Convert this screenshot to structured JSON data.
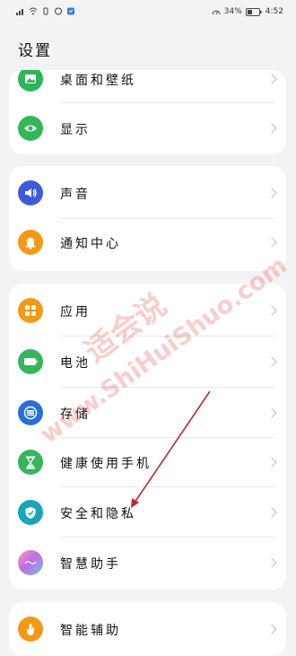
{
  "status_bar": {
    "battery_percent": "34%",
    "time": "4:52"
  },
  "header": {
    "title": "设置"
  },
  "cards": [
    {
      "items": [
        {
          "label": "桌面和壁纸",
          "icon": "wallpaper-icon",
          "color": "#2fb35b"
        },
        {
          "label": "显示",
          "icon": "eye-icon",
          "color": "#35b65b"
        }
      ]
    },
    {
      "items": [
        {
          "label": "声音",
          "icon": "speaker-icon",
          "color": "#3d5bd9"
        },
        {
          "label": "通知中心",
          "icon": "bell-icon",
          "color": "#f29a17"
        }
      ]
    },
    {
      "items": [
        {
          "label": "应用",
          "icon": "apps-icon",
          "color": "#f29a17"
        },
        {
          "label": "电池",
          "icon": "battery-icon",
          "color": "#35b65b"
        },
        {
          "label": "存储",
          "icon": "storage-icon",
          "color": "#2a6ed8"
        },
        {
          "label": "健康使用手机",
          "icon": "hourglass-icon",
          "color": "#35b65b"
        },
        {
          "label": "安全和隐私",
          "icon": "shield-icon",
          "color": "#1aa6b8"
        },
        {
          "label": "智慧助手",
          "icon": "assistant-icon",
          "color": "#c26ae0"
        }
      ]
    },
    {
      "items": [
        {
          "label": "智能辅助",
          "icon": "hand-icon",
          "color": "#f29a17"
        }
      ]
    }
  ],
  "watermark": {
    "line1": "适会说",
    "line2": "www.ShiHuiShuo.com"
  }
}
